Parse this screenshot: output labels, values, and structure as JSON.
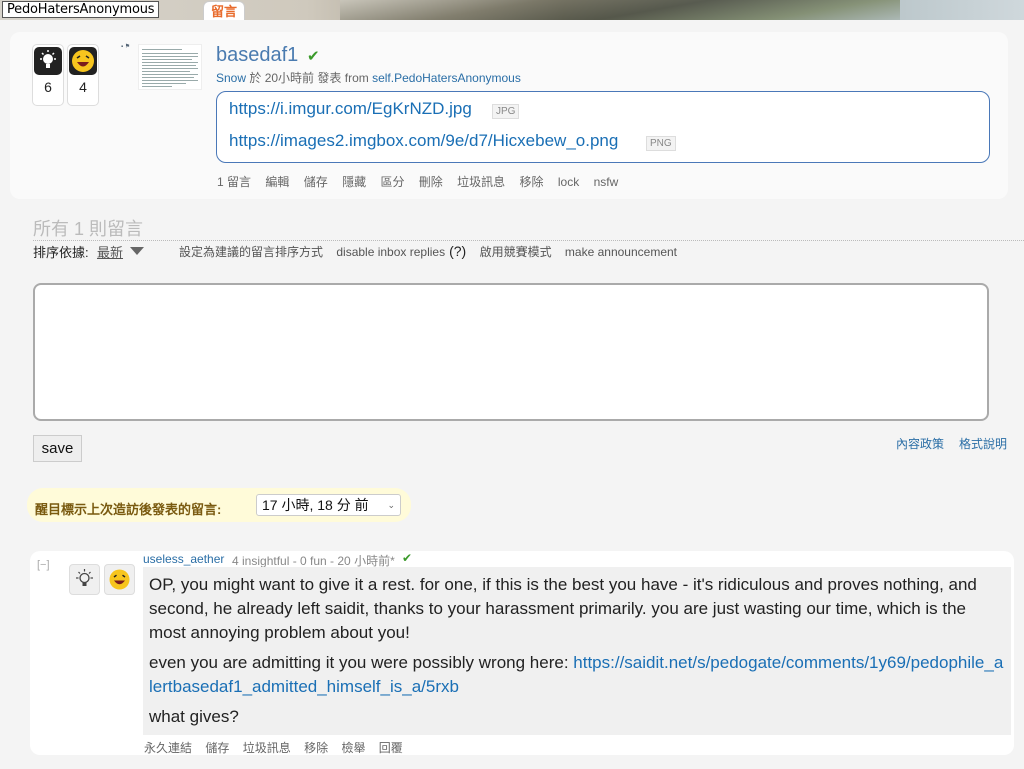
{
  "header": {
    "site_name": "PedoHatersAnonymous",
    "tab_label": "留言"
  },
  "post": {
    "insight_count": "6",
    "fun_count": "4",
    "title": "basedaf1",
    "check": "✔",
    "meta_user": "Snow",
    "meta_time": "於 20小時前 發表",
    "meta_from": "from",
    "meta_sub": "self.PedoHatersAnonymous",
    "links": [
      {
        "url": "https://i.imgur.com/EgKrNZD.jpg",
        "tag": "JPG"
      },
      {
        "url": "https://images2.imgbox.com/9e/d7/Hicxebew_o.png",
        "tag": "PNG"
      }
    ],
    "actions": [
      "1 留言",
      "編輯",
      "儲存",
      "隱藏",
      "區分",
      "刪除",
      "垃圾訊息",
      "移除",
      "lock",
      "nsfw"
    ]
  },
  "comments_section": {
    "all_comments": "所有 1 則留言",
    "sort_label": "排序依據:",
    "sort_value": "最新",
    "options": [
      "設定為建議的留言排序方式",
      "disable inbox replies",
      "(?)",
      "啟用競賽模式",
      "make announcement"
    ],
    "save_label": "save",
    "content_policy": "內容政策",
    "format_help": "格式說明",
    "highlight_label": "醒目標示上次造訪後發表的留言:",
    "highlight_value": "17 小時, 18 分 前"
  },
  "comment": {
    "collapse": "[−]",
    "author": "useless_aether",
    "meta": "4 insightful - 0 fun - 20 小時前*",
    "check": "✔",
    "paragraphs": [
      "OP, you might want to give it a rest. for one, if this is the best you have - it's ridiculous and proves nothing, and second, he already left saidit, thanks to your harassment primarily. you are just wasting our time, which is the most annoying problem about you!",
      "even you are admitting it you were possibly wrong here: ",
      "what gives?"
    ],
    "link": "https://saidit.net/s/pedogate/comments/1y69/pedophile_alertbasedaf1_admitted_himself_is_a/5rxb",
    "actions": [
      "永久連結",
      "儲存",
      "垃圾訊息",
      "移除",
      "檢舉",
      "回覆"
    ]
  },
  "icons": {
    "insight": "lightbulb-icon",
    "fun": "laughing-face-icon"
  }
}
